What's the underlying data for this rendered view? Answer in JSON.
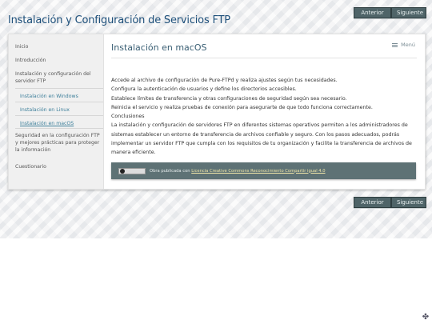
{
  "site": {
    "title": "Instalación y Configuración de Servicios FTP"
  },
  "nav_top": {
    "prev_label": "Anterior",
    "next_label": "Siguiente"
  },
  "nav_bottom": {
    "prev_label": "Anterior",
    "next_label": "Siguiente"
  },
  "sidebar": {
    "items": [
      {
        "label": "Inicio"
      },
      {
        "label": "Introducción"
      },
      {
        "label": "Instalación y configuración del servidor FTP"
      },
      {
        "label": "Instalación en Windows"
      },
      {
        "label": "Instalación en Linux"
      },
      {
        "label": "Instalación en macOS"
      },
      {
        "label": "Seguridad en la configuración FTP y mejores prácticas para proteger la información"
      },
      {
        "label": "Cuestionario"
      }
    ]
  },
  "page": {
    "title": "Instalación en macOS",
    "menu_label": "Menú",
    "lines": [
      "Accede al archivo de configuración de Pure-FTPd y realiza ajustes según tus necesidades.",
      "Configura la autenticación de usuarios y define los directorios accesibles.",
      "Establece límites de transferencia y otras configuraciones de seguridad según sea necesario.",
      "Reinicia el servicio y realiza pruebas de conexión para asegurarte de que todo funciona correctamente.",
      "Conclusiones",
      "La instalación y configuración de servidores FTP en diferentes sistemas operativos permiten a los administradores de sistemas establecer un entorno de transferencia de archivos confiable y seguro. Con los pasos adecuados, podrás implementar un servidor FTP que cumpla con los requisitos de tu organización y facilite la transferencia de archivos de manera eficiente."
    ]
  },
  "license": {
    "prefix": "Obra publicada con",
    "link_text": "Licencia Creative Commons Reconocimiento Compartir igual 4.0"
  },
  "colors": {
    "accent": "#3d7f9a",
    "button_bg": "#4f6468",
    "title": "#1d4f7a"
  }
}
